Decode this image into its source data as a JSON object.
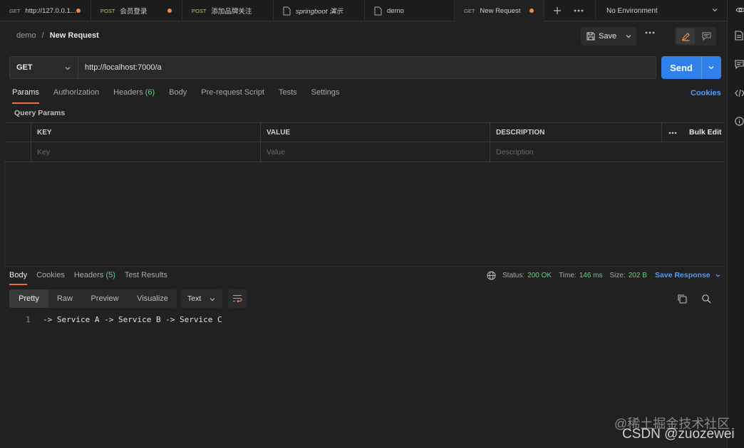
{
  "tabs": [
    {
      "method": "GET",
      "label": "http://127.0.0.1...",
      "unsaved": true,
      "italic": false,
      "icon": "none"
    },
    {
      "method": "POST",
      "label": "会员登录",
      "unsaved": true,
      "italic": false,
      "icon": "none"
    },
    {
      "method": "POST",
      "label": "添加品牌关注",
      "unsaved": false,
      "italic": false,
      "icon": "none"
    },
    {
      "method": "",
      "label": "springboot 演示",
      "unsaved": false,
      "italic": true,
      "icon": "doc-icon"
    },
    {
      "method": "",
      "label": "demo",
      "unsaved": false,
      "italic": false,
      "icon": "doc-icon"
    },
    {
      "method": "GET",
      "label": "New Request",
      "unsaved": true,
      "italic": false,
      "icon": "none"
    }
  ],
  "environment": "No Environment",
  "breadcrumb": {
    "parent": "demo",
    "separator": "/",
    "current": "New Request"
  },
  "toolbar": {
    "save_label": "Save"
  },
  "request": {
    "method": "GET",
    "url": "http://localhost:7000/a",
    "send_label": "Send"
  },
  "request_tabs": {
    "params": "Params",
    "authorization": "Authorization",
    "headers": "Headers",
    "headers_count": "(6)",
    "body": "Body",
    "pre_request": "Pre-request Script",
    "tests": "Tests",
    "settings": "Settings",
    "cookies": "Cookies"
  },
  "query_params": {
    "title": "Query Params",
    "headers": {
      "key": "KEY",
      "value": "VALUE",
      "description": "DESCRIPTION"
    },
    "bulk_edit": "Bulk Edit",
    "placeholders": {
      "key": "Key",
      "value": "Value",
      "description": "Description"
    }
  },
  "response_tabs": {
    "body": "Body",
    "cookies": "Cookies",
    "headers": "Headers",
    "headers_count": "(5)",
    "test_results": "Test Results"
  },
  "response_status": {
    "status_label": "Status:",
    "status_value": "200 OK",
    "time_label": "Time:",
    "time_value": "146 ms",
    "size_label": "Size:",
    "size_value": "202 B",
    "save_response": "Save Response"
  },
  "view_modes": {
    "pretty": "Pretty",
    "raw": "Raw",
    "preview": "Preview",
    "visualize": "Visualize"
  },
  "format": "Text",
  "response_body": [
    {
      "line": "1",
      "text": "-> Service A -> Service B -> Service C"
    }
  ],
  "watermark": {
    "line1": "@稀土掘金技术社区",
    "line2": "CSDN @zuozewei"
  },
  "colors": {
    "accent": "#f26b3a",
    "send": "#2f80e8",
    "link": "#4a9eff",
    "success": "#6bc98a",
    "post": "#e6b84a"
  }
}
